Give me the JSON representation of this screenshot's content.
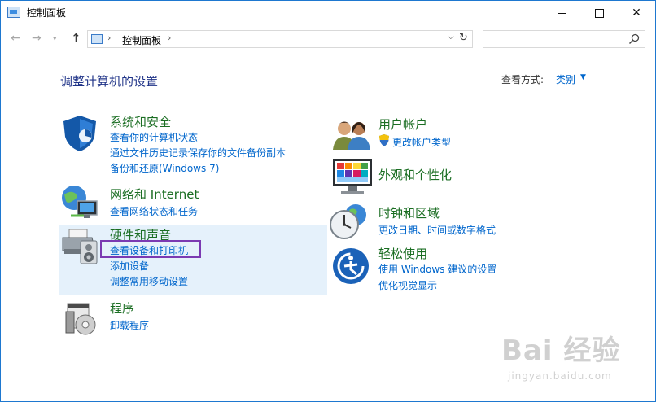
{
  "window": {
    "title": "控制面板"
  },
  "address": {
    "path": "控制面板"
  },
  "search": {
    "placeholder": ""
  },
  "main": {
    "heading": "调整计算机的设置",
    "view_by_label": "查看方式:",
    "view_by_value": "类别"
  },
  "categories": [
    {
      "title": "系统和安全",
      "links": [
        "查看你的计算机状态",
        "通过文件历史记录保存你的文件备份副本",
        "备份和还原(Windows 7)"
      ]
    },
    {
      "title": "网络和 Internet",
      "links": [
        "查看网络状态和任务"
      ]
    },
    {
      "title": "硬件和声音",
      "links": [
        "查看设备和打印机",
        "添加设备",
        "调整常用移动设置"
      ]
    },
    {
      "title": "程序",
      "links": [
        "卸载程序"
      ]
    },
    {
      "title": "用户帐户",
      "links": [
        "更改帐户类型"
      ]
    },
    {
      "title": "外观和个性化",
      "links": []
    },
    {
      "title": "时钟和区域",
      "links": [
        "更改日期、时间或数字格式"
      ]
    },
    {
      "title": "轻松使用",
      "links": [
        "使用 Windows 建议的设置",
        "优化视觉显示"
      ]
    }
  ],
  "watermark": {
    "main": "Bai 经验",
    "sub": "jingyan.baidu.com"
  },
  "colors": {
    "link": "#0066cc",
    "category": "#1b6e23",
    "heading": "#1e3287",
    "highlight": "#e5f1fb",
    "callout": "#7b3ab2"
  },
  "icons": [
    "control-panel-icon",
    "back-arrow-icon",
    "forward-arrow-icon",
    "up-arrow-icon",
    "refresh-icon",
    "search-icon",
    "shield-icon",
    "network-icon",
    "printer-speaker-icon",
    "programs-icon",
    "users-icon",
    "monitor-icon",
    "clock-globe-icon",
    "ease-of-access-icon"
  ]
}
